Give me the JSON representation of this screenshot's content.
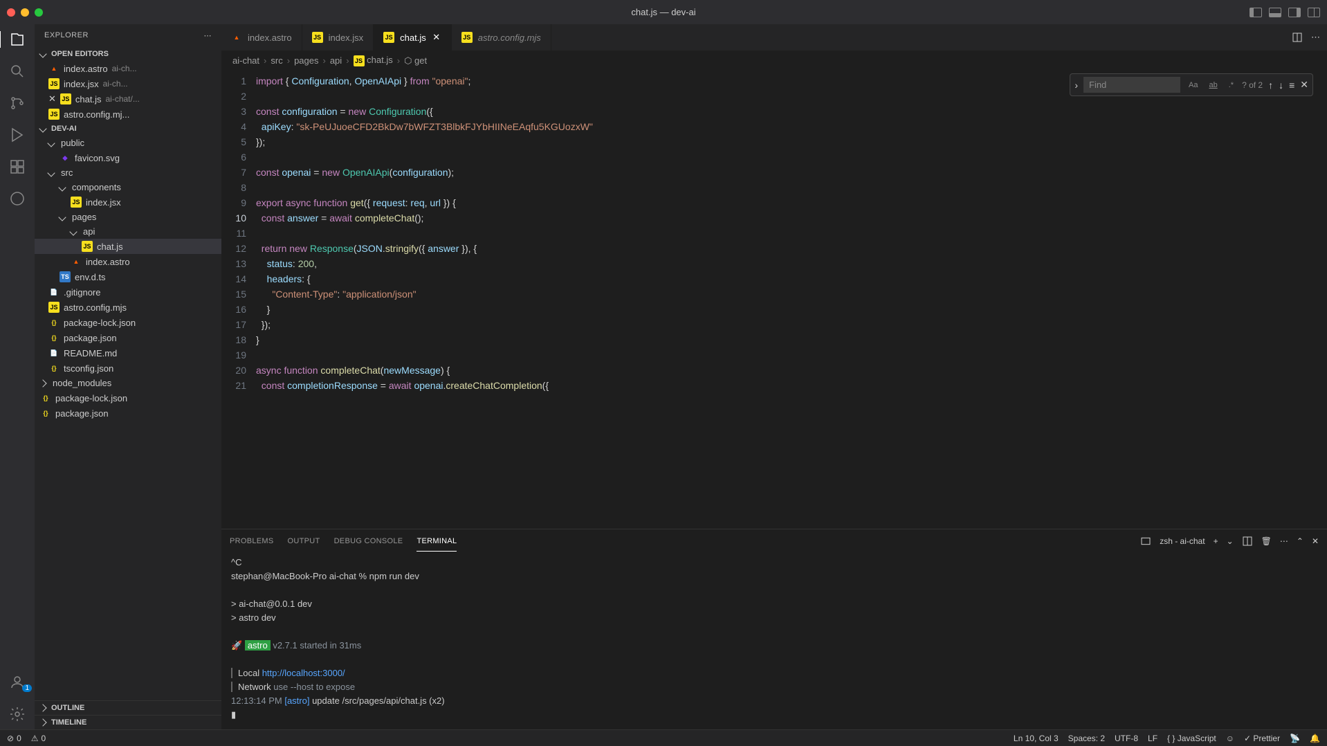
{
  "window": {
    "title": "chat.js — dev-ai"
  },
  "sidebar": {
    "title": "EXPLORER",
    "openEditors": {
      "label": "OPEN EDITORS",
      "items": [
        {
          "name": "index.astro",
          "path": "ai-ch...",
          "icon": "astro"
        },
        {
          "name": "index.jsx",
          "path": "ai-ch...",
          "icon": "jsx"
        },
        {
          "name": "chat.js",
          "path": "ai-chat/...",
          "icon": "js",
          "close": true
        },
        {
          "name": "astro.config.mj...",
          "path": "",
          "icon": "js"
        }
      ]
    },
    "project": {
      "label": "DEV-AI",
      "tree": [
        {
          "name": "public",
          "type": "folder",
          "indent": 1
        },
        {
          "name": "favicon.svg",
          "type": "file",
          "icon": "svg",
          "indent": 2
        },
        {
          "name": "src",
          "type": "folder",
          "indent": 1
        },
        {
          "name": "components",
          "type": "folder",
          "indent": 2
        },
        {
          "name": "index.jsx",
          "type": "file",
          "icon": "jsx",
          "indent": 3
        },
        {
          "name": "pages",
          "type": "folder",
          "indent": 2
        },
        {
          "name": "api",
          "type": "folder",
          "indent": 3
        },
        {
          "name": "chat.js",
          "type": "file",
          "icon": "js",
          "indent": 4,
          "selected": true
        },
        {
          "name": "index.astro",
          "type": "file",
          "icon": "astro",
          "indent": 3
        },
        {
          "name": "env.d.ts",
          "type": "file",
          "icon": "ts",
          "indent": 2
        },
        {
          "name": ".gitignore",
          "type": "file",
          "icon": "",
          "indent": 1
        },
        {
          "name": "astro.config.mjs",
          "type": "file",
          "icon": "js",
          "indent": 1
        },
        {
          "name": "package-lock.json",
          "type": "file",
          "icon": "json",
          "indent": 1
        },
        {
          "name": "package.json",
          "type": "file",
          "icon": "json",
          "indent": 1
        },
        {
          "name": "README.md",
          "type": "file",
          "icon": "",
          "indent": 1
        },
        {
          "name": "tsconfig.json",
          "type": "file",
          "icon": "json",
          "indent": 1
        },
        {
          "name": "node_modules",
          "type": "folder",
          "indent": 0,
          "collapsed": true
        },
        {
          "name": "package-lock.json",
          "type": "file",
          "icon": "json",
          "indent": 0
        },
        {
          "name": "package.json",
          "type": "file",
          "icon": "json",
          "indent": 0
        }
      ]
    },
    "outline": "OUTLINE",
    "timeline": "TIMELINE"
  },
  "tabs": [
    {
      "name": "index.astro",
      "icon": "astro"
    },
    {
      "name": "index.jsx",
      "icon": "jsx"
    },
    {
      "name": "chat.js",
      "icon": "js",
      "active": true,
      "close": true
    },
    {
      "name": "astro.config.mjs",
      "icon": "js",
      "dim": true
    }
  ],
  "breadcrumb": [
    "ai-chat",
    "src",
    "pages",
    "api",
    "chat.js",
    "get"
  ],
  "find": {
    "placeholder": "Find",
    "results": "? of 2"
  },
  "code": {
    "lines": [
      {
        "n": 1,
        "html": "<span class='kw'>import</span> <span class='punc'>{</span> <span class='var'>Configuration</span><span class='punc'>,</span> <span class='var'>OpenAIApi</span> <span class='punc'>}</span> <span class='kw'>from</span> <span class='str'>\"openai\"</span><span class='punc'>;</span>"
      },
      {
        "n": 2,
        "html": ""
      },
      {
        "n": 3,
        "html": "<span class='kw'>const</span> <span class='var'>configuration</span> <span class='punc'>=</span> <span class='kw'>new</span> <span class='cls'>Configuration</span><span class='punc'>({</span>"
      },
      {
        "n": 4,
        "html": "  <span class='var'>apiKey</span><span class='punc'>:</span> <span class='str'>\"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\"</span>"
      },
      {
        "n": 5,
        "html": "<span class='punc'>});</span>"
      },
      {
        "n": 6,
        "html": ""
      },
      {
        "n": 7,
        "html": "<span class='kw'>const</span> <span class='var'>openai</span> <span class='punc'>=</span> <span class='kw'>new</span> <span class='cls'>OpenAIApi</span><span class='punc'>(</span><span class='var'>configuration</span><span class='punc'>);</span>"
      },
      {
        "n": 8,
        "html": ""
      },
      {
        "n": 9,
        "html": "<span class='kw'>export</span> <span class='kw'>async</span> <span class='kw'>function</span> <span class='fn'>get</span><span class='punc'>({</span> <span class='var'>request</span><span class='punc'>:</span> <span class='var'>req</span><span class='punc'>,</span> <span class='var'>url</span> <span class='punc'>}) {</span>"
      },
      {
        "n": 10,
        "html": "  <span class='kw'>const</span> <span class='var'>answer</span> <span class='punc'>=</span> <span class='kw'>await</span> <span class='fn'>completeChat</span><span class='punc'>();</span>",
        "active": true
      },
      {
        "n": 11,
        "html": ""
      },
      {
        "n": 12,
        "html": "  <span class='kw'>return</span> <span class='kw'>new</span> <span class='cls'>Response</span><span class='punc'>(</span><span class='var'>JSON</span><span class='punc'>.</span><span class='fn'>stringify</span><span class='punc'>({</span> <span class='var'>answer</span> <span class='punc'>}), {</span>"
      },
      {
        "n": 13,
        "html": "    <span class='var'>status</span><span class='punc'>:</span> <span class='num'>200</span><span class='punc'>,</span>"
      },
      {
        "n": 14,
        "html": "    <span class='var'>headers</span><span class='punc'>: {</span>"
      },
      {
        "n": 15,
        "html": "      <span class='str'>\"Content-Type\"</span><span class='punc'>:</span> <span class='str'>\"application/json\"</span>"
      },
      {
        "n": 16,
        "html": "    <span class='punc'>}</span>"
      },
      {
        "n": 17,
        "html": "  <span class='punc'>});</span>"
      },
      {
        "n": 18,
        "html": "<span class='punc'>}</span>"
      },
      {
        "n": 19,
        "html": ""
      },
      {
        "n": 20,
        "html": "<span class='kw'>async</span> <span class='kw'>function</span> <span class='fn'>completeChat</span><span class='punc'>(</span><span class='param'>newMessage</span><span class='punc'>) {</span>"
      },
      {
        "n": 21,
        "html": "  <span class='kw'>const</span> <span class='var'>completionResponse</span> <span class='punc'>=</span> <span class='kw'>await</span> <span class='var'>openai</span><span class='punc'>.</span><span class='fn'>createChatCompletion</span><span class='punc'>({</span>"
      }
    ]
  },
  "panel": {
    "tabs": [
      "PROBLEMS",
      "OUTPUT",
      "DEBUG CONSOLE",
      "TERMINAL"
    ],
    "active": "TERMINAL",
    "shell": "zsh - ai-chat"
  },
  "terminal": {
    "lines": [
      "^C",
      "stephan@MacBook-Pro ai-chat % npm run dev",
      "",
      "> ai-chat@0.0.1 dev",
      "> astro dev",
      "",
      {
        "rocket": "🚀",
        "badge": "astro",
        "rest": " v2.7.1 started in 31ms"
      },
      "",
      {
        "label": "Local",
        "link": "http://localhost:3000/"
      },
      {
        "label": "Network",
        "dim": "use --host to expose"
      },
      {
        "time": "12:13:14 PM",
        "tag": "[astro]",
        "msg": " update /src/pages/api/chat.js (x2)"
      }
    ]
  },
  "statusbar": {
    "errors": "0",
    "warnings": "0",
    "position": "Ln 10, Col 3",
    "spaces": "Spaces: 2",
    "encoding": "UTF-8",
    "eol": "LF",
    "lang": "JavaScript",
    "prettier": "Prettier"
  }
}
